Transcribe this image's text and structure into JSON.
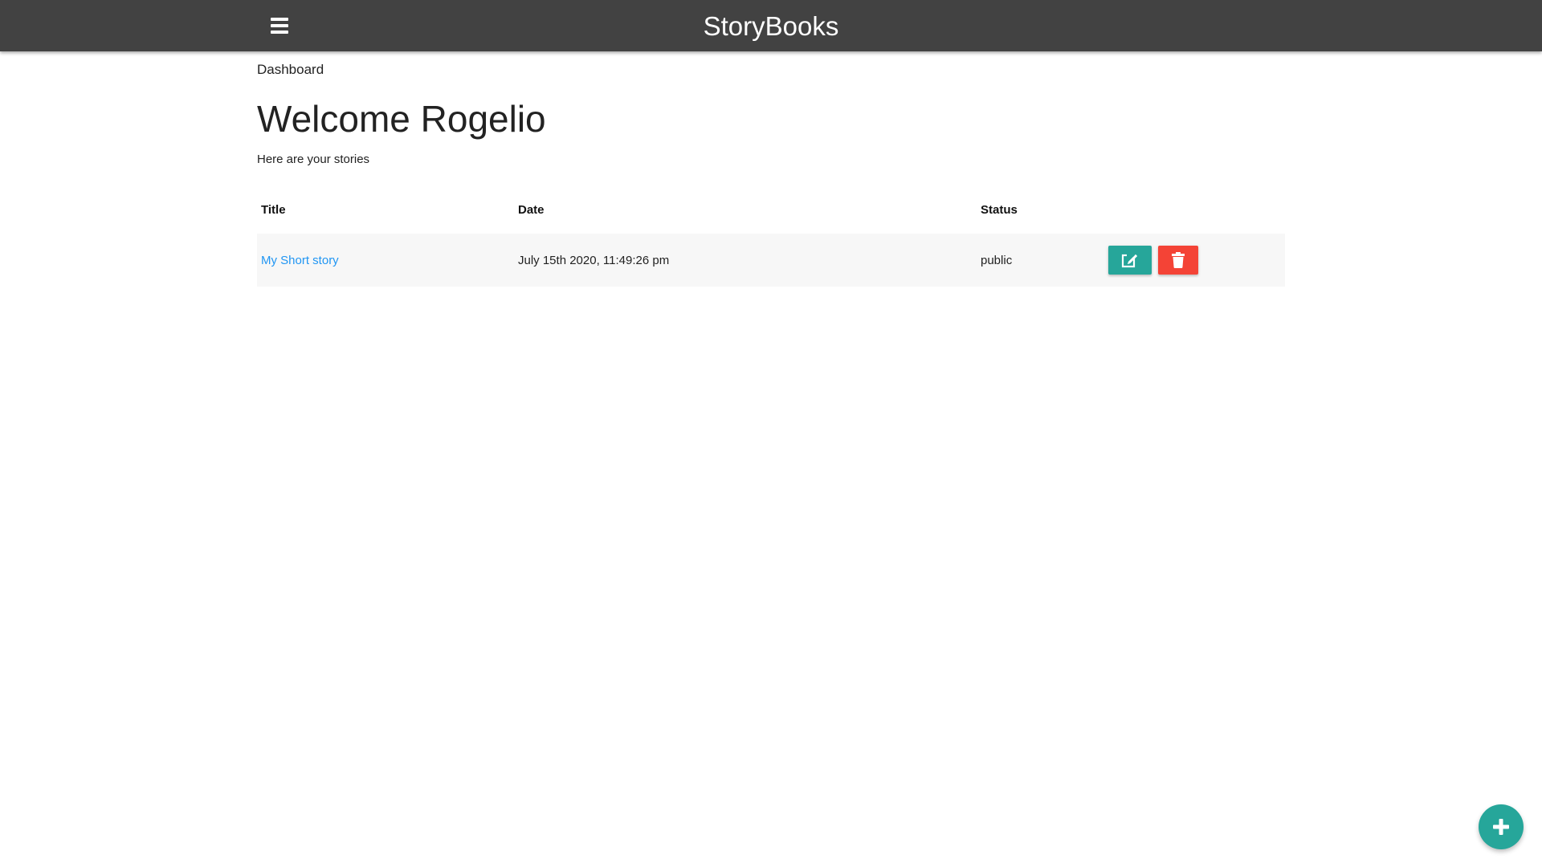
{
  "navbar": {
    "brand": "StoryBooks",
    "menu_icon": "hamburger-menu-icon",
    "background": "#424242"
  },
  "main": {
    "breadcrumb": "Dashboard",
    "welcome": "Welcome Rogelio",
    "subtitle": "Here are your stories"
  },
  "stories_table": {
    "columns": [
      "Title",
      "Date",
      "Status"
    ],
    "rows": [
      {
        "title": "My Short story",
        "date": "July 15th 2020, 11:49:26 pm",
        "status": "public",
        "actions": [
          {
            "icon": "edit-icon",
            "color": "#26a69a"
          },
          {
            "icon": "trash-icon",
            "color": "#f44336"
          }
        ]
      }
    ]
  },
  "fab": {
    "icon": "plus-icon",
    "color": "#26a69a"
  },
  "colors": {
    "link": "#2196f3",
    "row_background": "#f7f7f7"
  }
}
